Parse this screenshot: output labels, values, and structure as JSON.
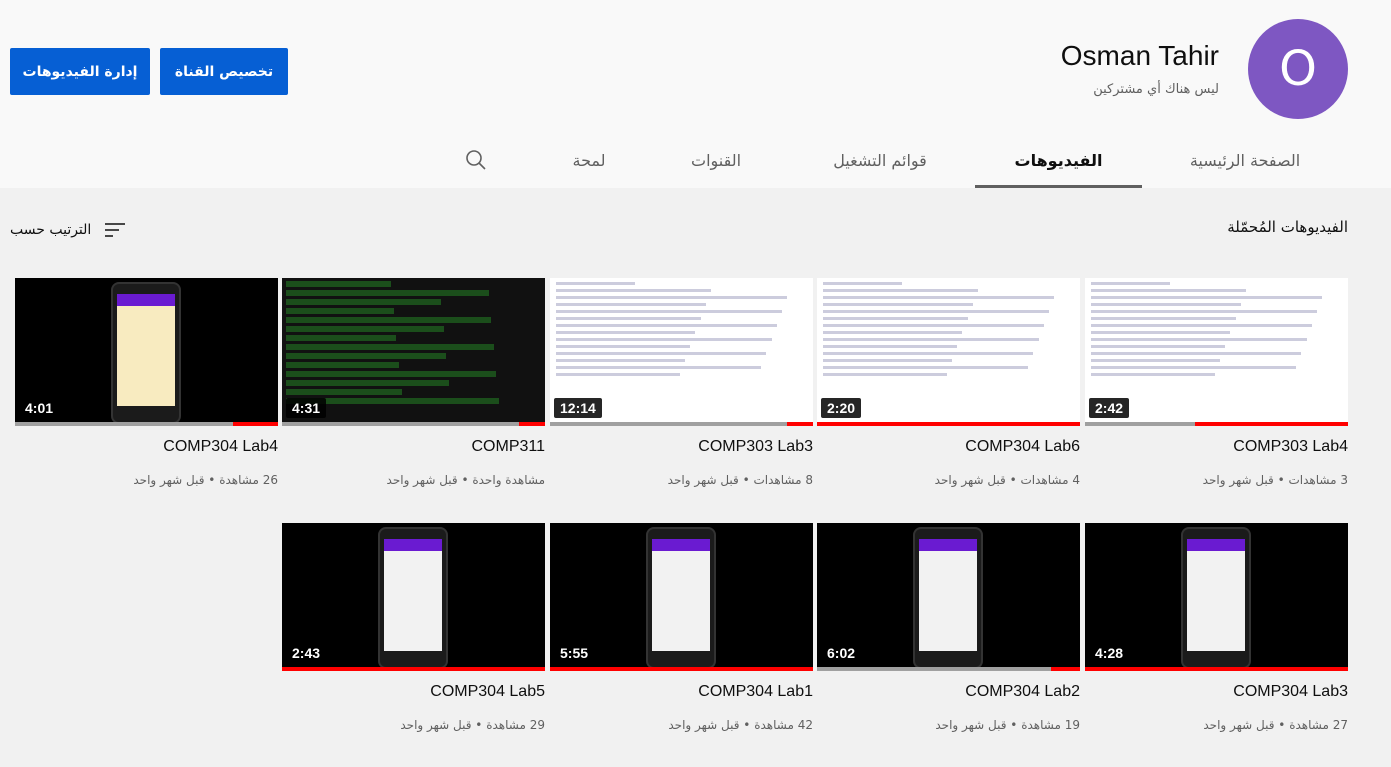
{
  "header": {
    "manage_videos_label": "إدارة الفيديوهات",
    "customize_channel_label": "تخصيص القناة",
    "avatar_letter": "O",
    "channel_name": "Osman Tahir",
    "subscribers": "ليس هناك أي مشتركين"
  },
  "tabs": {
    "home": "الصفحة الرئيسية",
    "videos": "الفيديوهات",
    "playlists": "قوائم التشغيل",
    "channels": "القنوات",
    "about": "لمحة"
  },
  "content": {
    "section_title": "الفيديوهات المُحمّلة",
    "sort_label": "الترتيب حسب"
  },
  "colors": {
    "primary_button": "#065fd4",
    "avatar": "#7e57c2",
    "progress": "#ff0000"
  },
  "videos": [
    {
      "title": "COMP303 Lab4",
      "duration": "2:42",
      "meta": "3 مشاهدات • قبل شهر واحد",
      "watched_percent": 58,
      "thumb": "ide"
    },
    {
      "title": "COMP304 Lab6",
      "duration": "2:20",
      "meta": "4 مشاهدات • قبل شهر واحد",
      "watched_percent": 100,
      "thumb": "ide"
    },
    {
      "title": "COMP303 Lab3",
      "duration": "12:14",
      "meta": "8 مشاهدات • قبل شهر واحد",
      "watched_percent": 10,
      "thumb": "ide"
    },
    {
      "title": "COMP311",
      "duration": "4:31",
      "meta": "مشاهدة واحدة • قبل شهر واحد",
      "watched_percent": 10,
      "thumb": "term"
    },
    {
      "title": "COMP304 Lab4",
      "duration": "4:01",
      "meta": "26 مشاهدة • قبل شهر واحد",
      "watched_percent": 17,
      "thumb": "phone"
    },
    {
      "title": "COMP304 Lab3",
      "duration": "4:28",
      "meta": "27 مشاهدة • قبل شهر واحد",
      "watched_percent": 100,
      "thumb": "phone"
    },
    {
      "title": "COMP304 Lab2",
      "duration": "6:02",
      "meta": "19 مشاهدة • قبل شهر واحد",
      "watched_percent": 11,
      "thumb": "phone"
    },
    {
      "title": "COMP304 Lab1",
      "duration": "5:55",
      "meta": "42 مشاهدة • قبل شهر واحد",
      "watched_percent": 100,
      "thumb": "phone"
    },
    {
      "title": "COMP304 Lab5",
      "duration": "2:43",
      "meta": "29 مشاهدة • قبل شهر واحد",
      "watched_percent": 100,
      "thumb": "phone"
    }
  ]
}
